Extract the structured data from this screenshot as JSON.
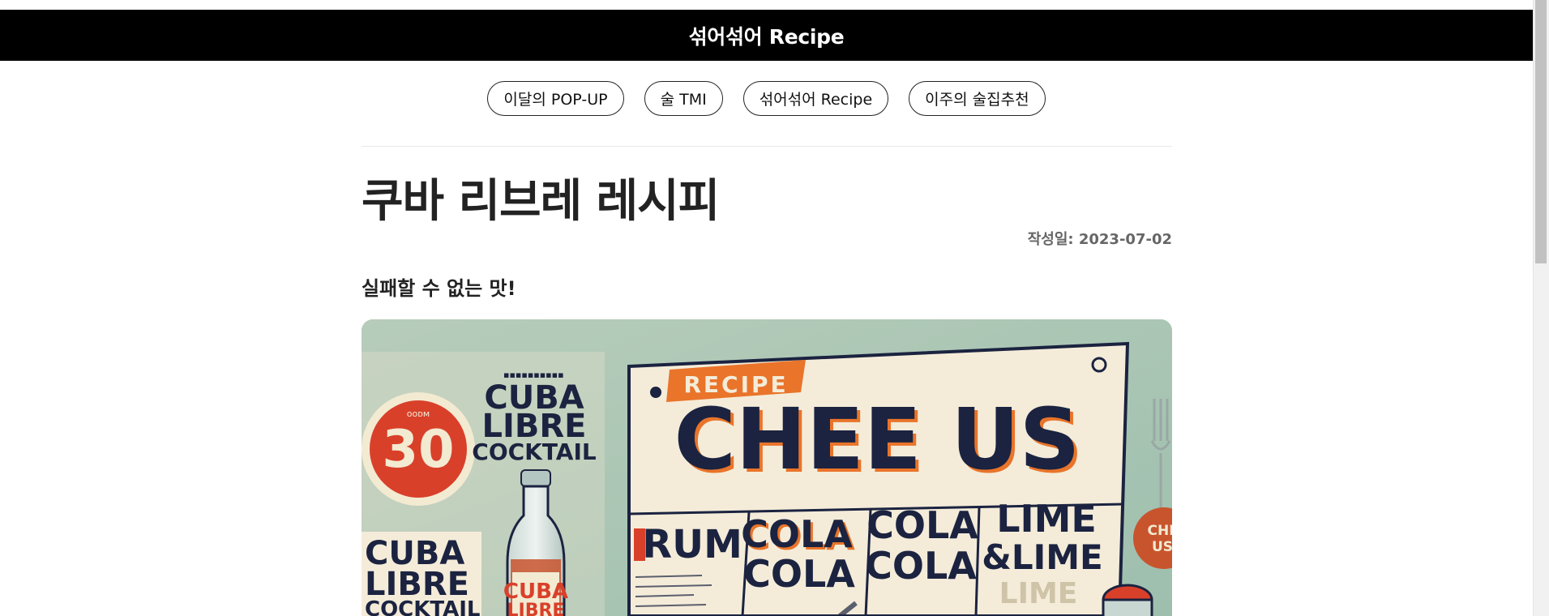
{
  "header": {
    "title": "섞어섞어 Recipe"
  },
  "nav": {
    "items": [
      {
        "label": "이달의 POP-UP"
      },
      {
        "label": "술 TMI"
      },
      {
        "label": "섞어섞어 Recipe"
      },
      {
        "label": "이주의 술집추천"
      }
    ]
  },
  "article": {
    "title": "쿠바 리브레 레시피",
    "date": "작성일: 2023-07-02",
    "subtitle": "실패할 수 없는 맛!",
    "hero": {
      "badge_number": "30",
      "badge_small": "ᴏᴏᴅᴍ",
      "left_title_line1": "CUBA",
      "left_title_line2": "LIBRE",
      "left_title_line3": "COCKTAIL",
      "left_top_dots": "▪▪▪▪▪▪▪▪▪▪",
      "lower_title_line1": "CUBA",
      "lower_title_line2": "LIBRE",
      "lower_title_line3": "COCKTAIL",
      "bottle_label_line1": "CUBA",
      "bottle_label_line2": "LIBRE",
      "recipe_tag": "RECIPE",
      "board_heading": "CHEE US",
      "col1": "RUM",
      "col2_line1": "COLA",
      "col2_line2": "COLA",
      "col3_line1": "COLA",
      "col3_line2": "COLA",
      "col4_line1": "LIME",
      "col4_line2": "&LIME",
      "col4_line3": "LIME",
      "round_sticker_line1": "CHI",
      "round_sticker_line2": "US",
      "colors": {
        "background": "#a9c4b3",
        "board": "#f4ecd9",
        "navy": "#1b2340",
        "orange": "#e9742a",
        "red": "#d9402a"
      }
    }
  },
  "scrollbar": {
    "position_fraction": 0.0
  }
}
